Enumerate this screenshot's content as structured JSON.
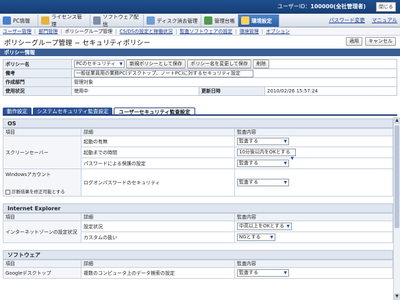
{
  "header": {
    "user_label": "ユーザーID：",
    "user_value": "100000(全社管理者)",
    "close": "閉じる"
  },
  "nav": {
    "tabs": [
      {
        "label": "PC情報",
        "color": "#4a7fd0"
      },
      {
        "label": "ライセンス管理",
        "color": "#e7b23a"
      },
      {
        "label": "ソフトウェア配信",
        "color": "#7e8ea6"
      },
      {
        "label": "ディスク消去管理",
        "color": "#6e9ed6"
      },
      {
        "label": "管理台帳",
        "color": "#4f9a4a"
      },
      {
        "label": "環境設定",
        "color": "#ffd25a"
      }
    ],
    "right_links": [
      "パスワード変更",
      "マニュアル"
    ]
  },
  "subnav": {
    "items": [
      {
        "label": "ユーザー管理",
        "link": true
      },
      {
        "label": "部門管理",
        "link": true
      },
      {
        "label": "ポリシーグループ管理",
        "link": false
      },
      {
        "label": "CS/DSの設定と稼働状況",
        "link": true
      },
      {
        "label": "監査ソフトウェアの設定",
        "link": true
      },
      {
        "label": "環境管理",
        "link": true
      },
      {
        "label": "オプション",
        "link": true
      }
    ]
  },
  "page": {
    "title": "ポリシーグループ管理 − セキュリティポリシー",
    "apply": "適用",
    "cancel": "キャンセル"
  },
  "policy_info": {
    "section": "ポリシー情報",
    "rows": {
      "name_label": "ポリシー名",
      "name_value": "PCのセキュリティ",
      "btn_new": "新規ポリシーとして保存",
      "btn_rename": "ポリシー名を変更して保存",
      "btn_delete": "削除",
      "note_label": "備考",
      "note_value": "一般従業員用の業務PC(デスクトップ、ノートPC)に対するセキュリティ設定",
      "dept_label": "作成部門",
      "dept_value": "管理対象",
      "status_label": "使用状況",
      "status_value": "使用中",
      "updated_label": "更新日時",
      "updated_value": "2010/02/26 15:57:24"
    }
  },
  "tabs": [
    "動作設定",
    "システムセキュリティ監査設定",
    "ユーザーセキュリティ監査設定"
  ],
  "cols": {
    "item": "項目",
    "detail": "詳細",
    "audit": "監査内容"
  },
  "groups": {
    "os": {
      "title": "OS",
      "screensaver": "スクリーンセーバー",
      "ss_enable": "起動の有無",
      "ss_enable_value": "監査する",
      "ss_time": "起動までの時間",
      "ss_time_value": "10分後以内をOKとする",
      "ss_pwd": "パスワードによる保護の設定",
      "ss_pwd_value": "監査する",
      "win_acct": "Windowsアカウント",
      "win_acct_chk": "診断結果を修正可能とする",
      "logon_pwd": "ログオンパスワードのセキュリティ",
      "logon_pwd_value": "監査する"
    },
    "ie": {
      "title": "Internet Explorer",
      "zone": "インターネットゾーンの設定状況",
      "setting": "設定状況",
      "setting_value": "中高以上をOKとする",
      "custom": "カスタムの扱い",
      "custom_value": "NGとする"
    },
    "sw": {
      "title": "ソフトウェア",
      "gdesk": "Googleデスクトップ",
      "gdesk_detail": "複数のコンピュータ上のデータ検索の設定",
      "gdesk_value": "監査する"
    }
  }
}
